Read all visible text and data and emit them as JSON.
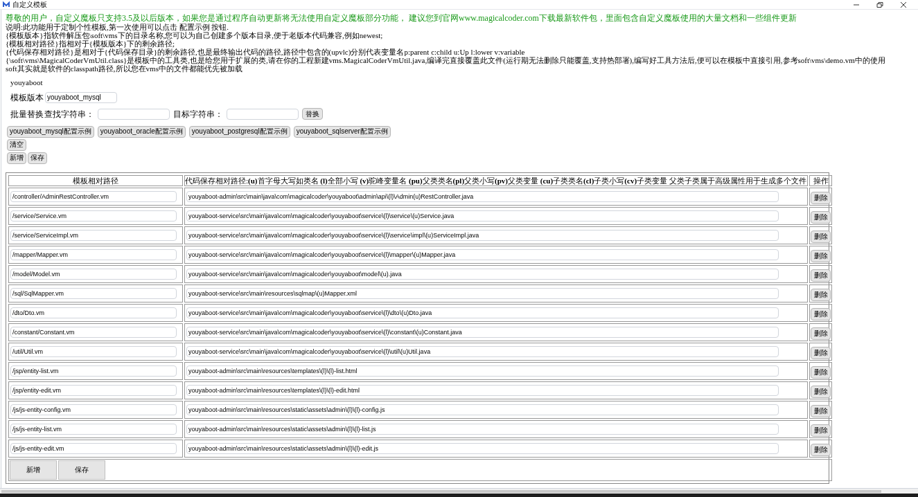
{
  "window": {
    "title": "自定义模板"
  },
  "notice": "尊敬的用户，自定义魔板只支持3.5及以后版本，如果您是通过程序自动更新将无法使用自定义魔板部分功能， 建议您到官网www.magicalcoder.com下载最新软件包，里面包含自定义魔板使用的大量文档和一些组件更新",
  "help_lines": [
    "说明:此功能用于定制个性模板,第一次使用可以点击 配置示例 按钮.",
    "{模板版本}指软件解压包\\soft\\vms下的目录名称,您可以为自己创建多个版本目录,便于老版本代码兼容,例如newest;",
    "{模板相对路径}指相对于{模板版本}下的剩余路径;",
    "{代码保存相对路径}是相对于{代码保存目录}的剩余路径,也是最终输出代码的路径,路径中包含的(upvlc)分别代表变量名p:parent c:child u:Up l:lower v:variable",
    "{\\soft\\vms\\MagicalCoderVmUtil.class}是模板中的工具类,也是给您用于扩展的类,请在你的工程新建vms.MagicalCoderVmUtil.java,编译完直接覆盖此文件(运行期无法删除只能覆盖,支持热部署),编写好工具方法后,便可以在模板中直接引用,参考soft\\vms\\demo.vm中的使用",
    "soft其实就是软件的classpath路径,所以您在vms中的文件都能优先被加载"
  ],
  "project_name": "youyaboot",
  "template_version": {
    "label": "模板版本",
    "value": "youyaboot_mysql"
  },
  "batch_replace": {
    "label": "批量替换",
    "find_label": "查找字符串：",
    "target_label": "目标字符串：",
    "button": "替换"
  },
  "example_buttons": [
    "youyaboot_mysql配置示例",
    "youyaboot_oracle配置示例",
    "youyaboot_postgresql配置示例",
    "youyaboot_sqlserver配置示例"
  ],
  "clear_button": "清空",
  "top_actions": [
    "新增",
    "保存"
  ],
  "table": {
    "columns": [
      "模板相对路径",
      "代码保存相对路径:**(u)**首字母大写如类名 **(l)**全部小写 **(v)**驼峰变量名 **(pu)**父类类名**(pl)**父类小写**(pv)**父类变量 **(cu)**子类类名**(cl)**子类小写**(cv)**子类变量 父类子类属于高级属性用于生成多个文件",
      "操作"
    ],
    "rows": [
      {
        "template": "/controller/AdminRestController.vm",
        "path": "youyaboot-admin\\src\\main\\java\\com\\magicalcoder\\youyaboot\\admin\\api\\(l)\\Admin(u)RestController.java",
        "action": "删除"
      },
      {
        "template": "/service/Service.vm",
        "path": "youyaboot-service\\src\\main\\java\\com\\magicalcoder\\youyaboot\\service\\(l)\\service\\(u)Service.java",
        "action": "删除"
      },
      {
        "template": "/service/ServiceImpl.vm",
        "path": "youyaboot-service\\src\\main\\java\\com\\magicalcoder\\youyaboot\\service\\(l)\\service\\impl\\(u)ServiceImpl.java",
        "action": "删除"
      },
      {
        "template": "/mapper/Mapper.vm",
        "path": "youyaboot-service\\src\\main\\java\\com\\magicalcoder\\youyaboot\\service\\(l)\\mapper\\(u)Mapper.java",
        "action": "删除"
      },
      {
        "template": "/model/Model.vm",
        "path": "youyaboot-service\\src\\main\\java\\com\\magicalcoder\\youyaboot\\model\\(u).java",
        "action": "删除"
      },
      {
        "template": "/sql/SqlMapper.vm",
        "path": "youyaboot-service\\src\\main\\resources\\sqlmap\\(u)Mapper.xml",
        "action": "删除"
      },
      {
        "template": "/dto/Dto.vm",
        "path": "youyaboot-service\\src\\main\\java\\com\\magicalcoder\\youyaboot\\service\\(l)\\dto\\(u)Dto.java",
        "action": "删除"
      },
      {
        "template": "/constant/Constant.vm",
        "path": "youyaboot-service\\src\\main\\java\\com\\magicalcoder\\youyaboot\\service\\(l)\\constant\\(u)Constant.java",
        "action": "删除"
      },
      {
        "template": "/util/Util.vm",
        "path": "youyaboot-service\\src\\main\\java\\com\\magicalcoder\\youyaboot\\service\\(l)\\util\\(u)Util.java",
        "action": "删除"
      },
      {
        "template": "/jsp/entity-list.vm",
        "path": "youyaboot-admin\\src\\main\\resources\\templates\\(l)\\(l)-list.html",
        "action": "删除"
      },
      {
        "template": "/jsp/entity-edit.vm",
        "path": "youyaboot-admin\\src\\main\\resources\\templates\\(l)\\(l)-edit.html",
        "action": "删除"
      },
      {
        "template": "/js/js-entity-config.vm",
        "path": "youyaboot-admin\\src\\main\\resources\\static\\assets\\admin\\(l)\\(l)-config.js",
        "action": "删除"
      },
      {
        "template": "/js/js-entity-list.vm",
        "path": "youyaboot-admin\\src\\main\\resources\\static\\assets\\admin\\(l)\\(l)-list.js",
        "action": "删除"
      },
      {
        "template": "/js/js-entity-edit.vm",
        "path": "youyaboot-admin\\src\\main\\resources\\static\\assets\\admin\\(l)\\(l)-edit.js",
        "action": "删除"
      }
    ]
  },
  "bottom_actions": [
    "新增",
    "保存"
  ]
}
